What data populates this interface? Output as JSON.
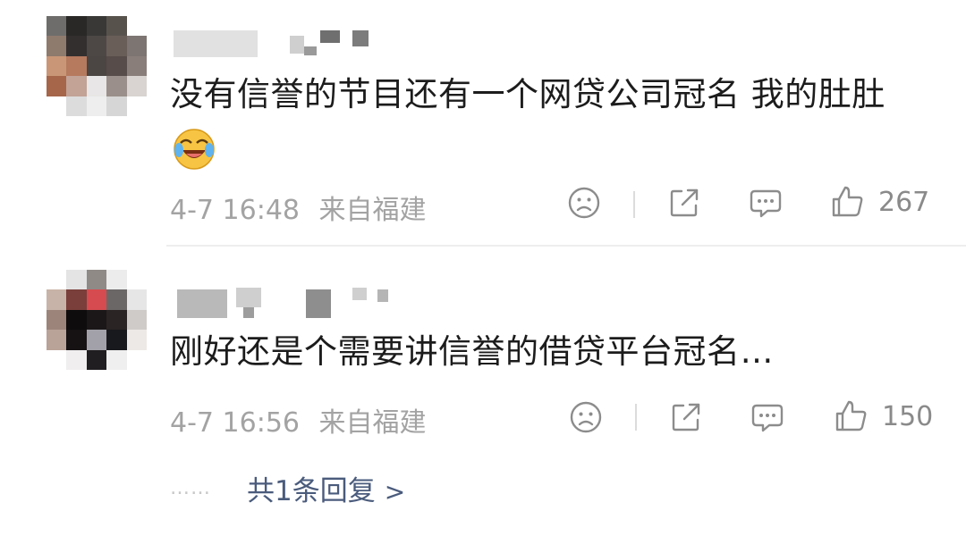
{
  "comments": [
    {
      "text": "没有信誉的节目还有一个网贷公司冠名 我的肚肚",
      "emoji": "laugh-cry-emoji",
      "time": "4-7 16:48",
      "location": "来自福建",
      "likes": "267"
    },
    {
      "text": "刚好还是个需要讲信誉的借贷平台冠名…",
      "time": "4-7 16:56",
      "location": "来自福建",
      "likes": "150",
      "replies": {
        "dots": "……",
        "label": "共1条回复",
        "chevron": ">"
      }
    }
  ],
  "icons": {
    "dislike": "sad-face-icon",
    "share": "share-icon",
    "comment": "comment-icon",
    "like": "thumbs-up-icon"
  },
  "colors": {
    "meta_text": "#a3a3a3",
    "reply_link": "#4a5b7c",
    "divider": "#eeeeee"
  }
}
